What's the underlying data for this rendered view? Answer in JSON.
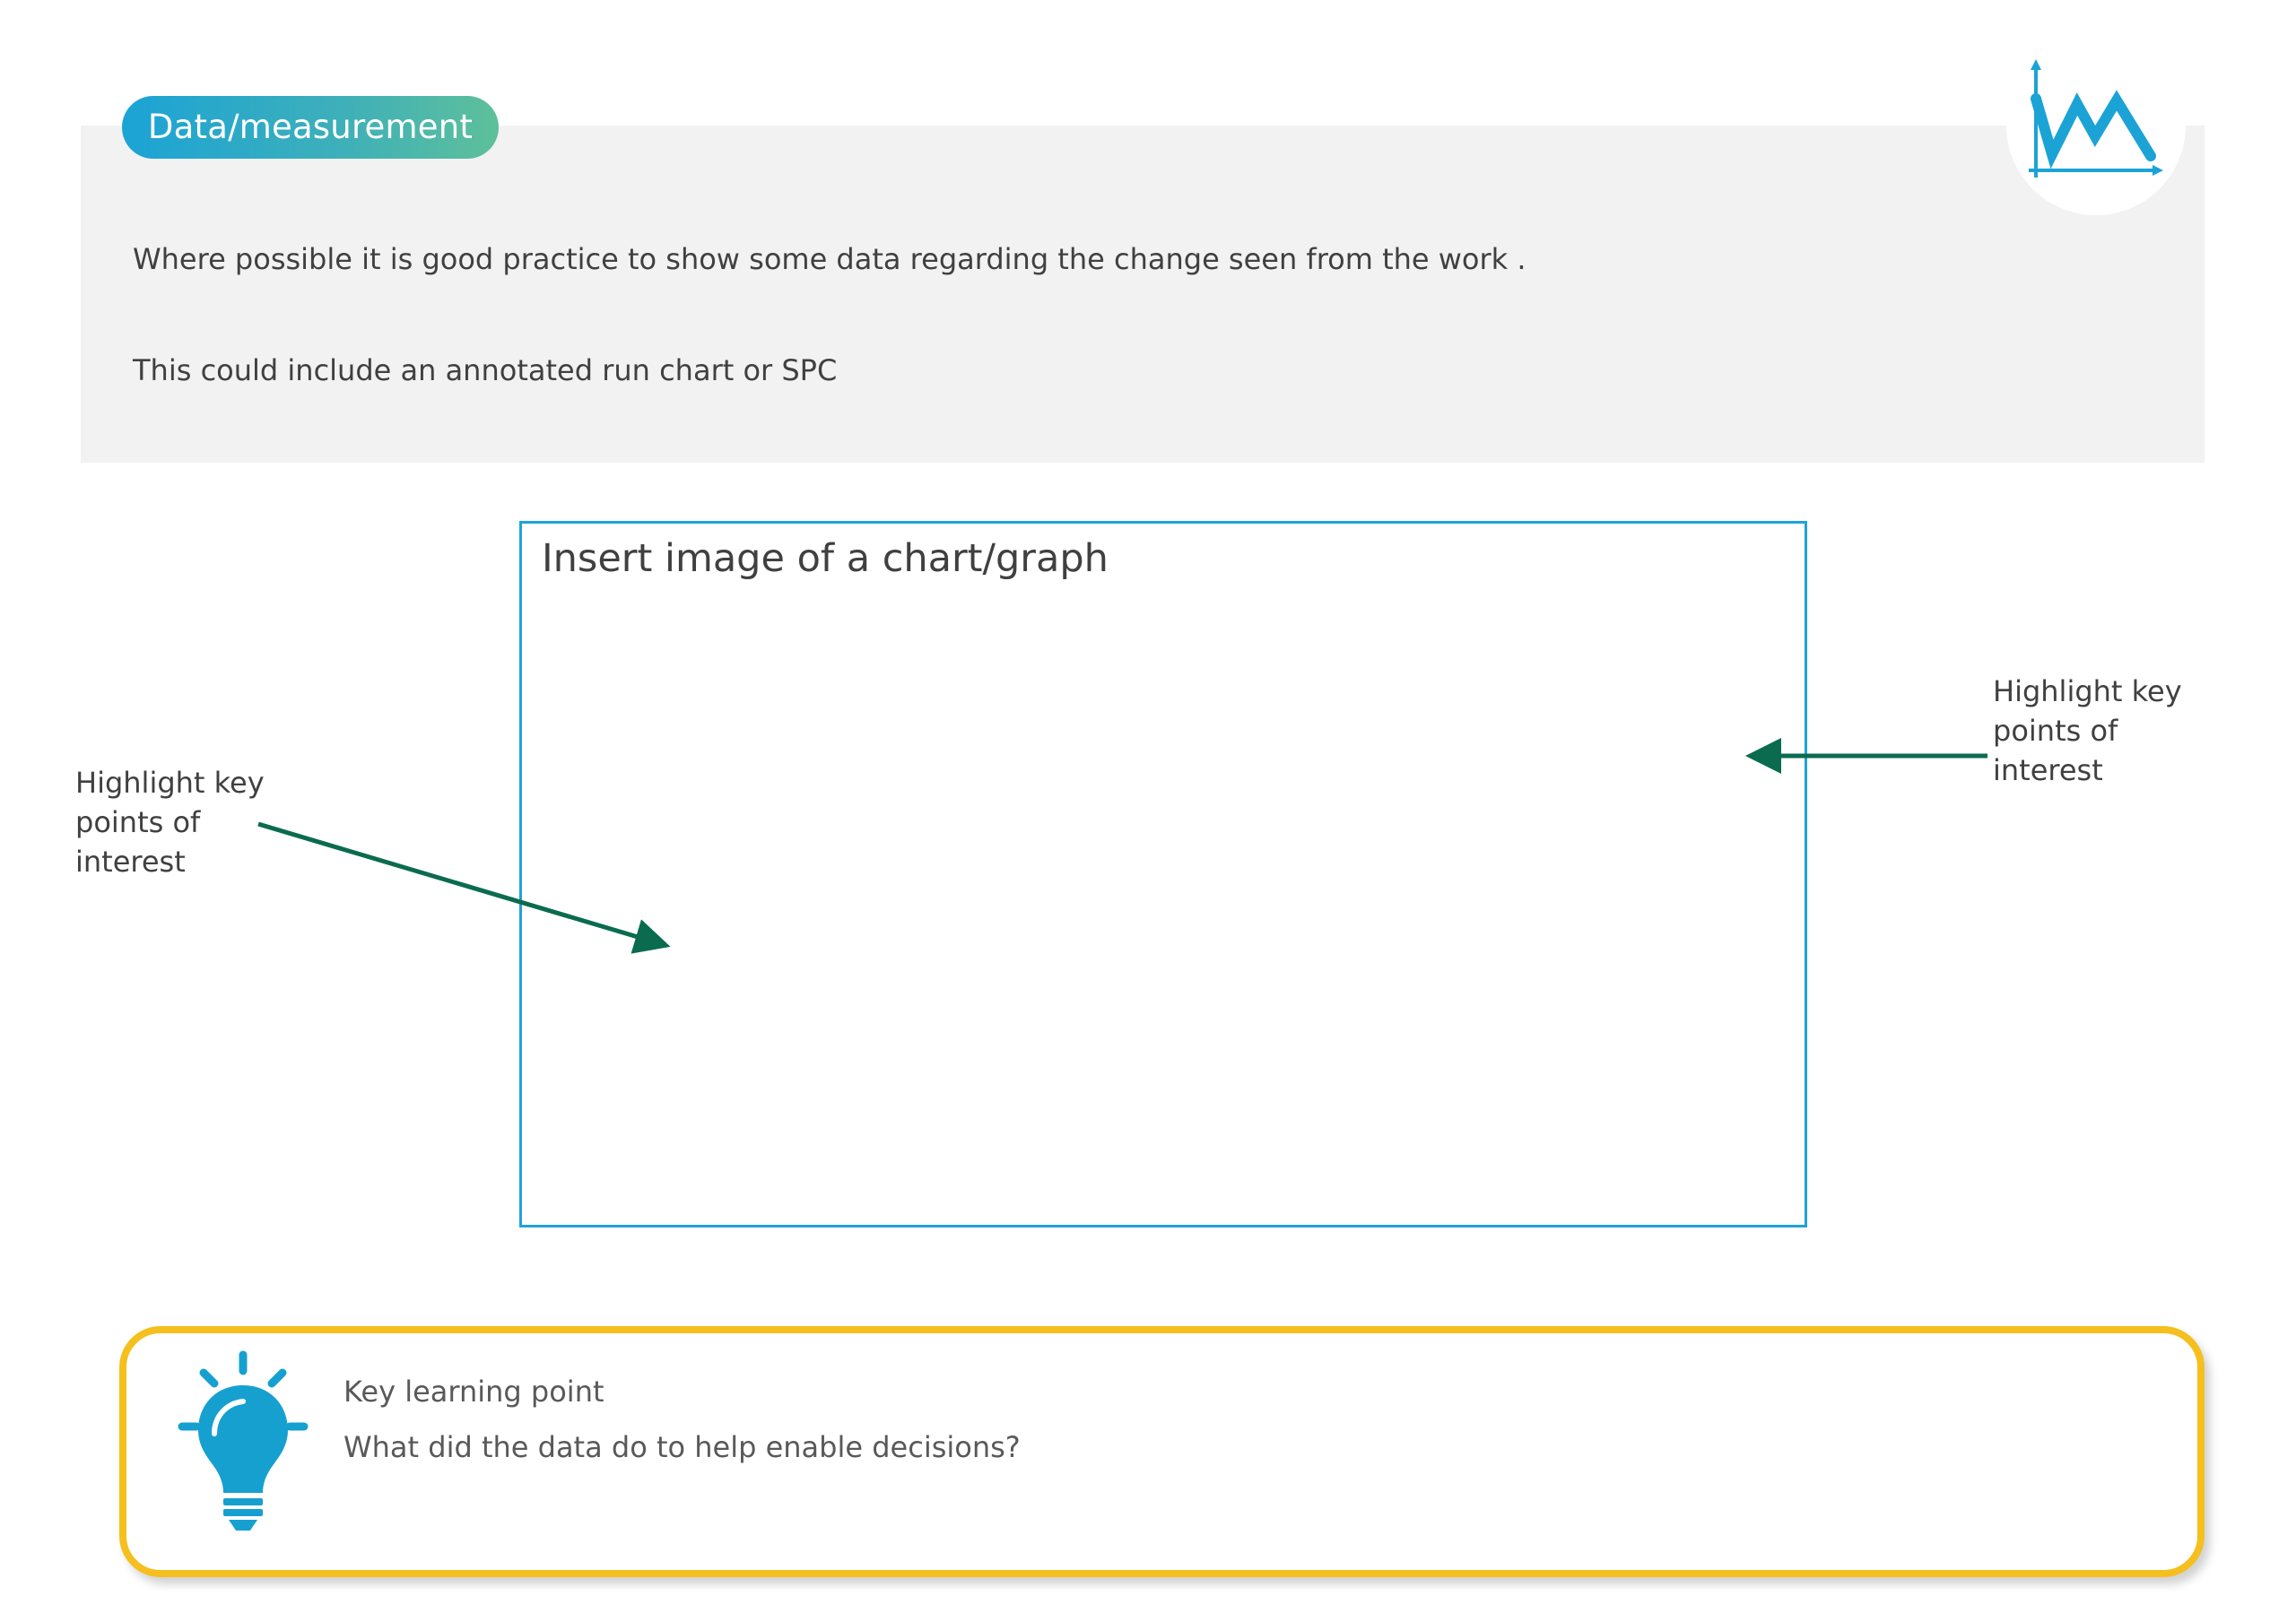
{
  "header": {
    "badge_label": "Data/measurement",
    "intro_line_1": "Where possible it is good practice to show some data regarding the change seen from the work .",
    "intro_line_2": "This could include an annotated run chart or SPC"
  },
  "icons": {
    "header_icon": "line-chart-icon",
    "learning_icon": "lightbulb-icon"
  },
  "placeholder": {
    "title": "Insert image of a chart/graph"
  },
  "annotations": {
    "left_text": "Highlight key points of interest",
    "right_text": "Highlight key points of interest"
  },
  "learning": {
    "title": "Key learning point",
    "question": "What did the data do to help enable decisions?"
  },
  "colors": {
    "accent_blue": "#1fa3d9",
    "badge_gradient_end": "#5ec09a",
    "panel_grey": "#f2f2f2",
    "arrow_green": "#0b6b4f",
    "learning_border": "#f5bf1d",
    "bulb_blue": "#16a0cf"
  }
}
